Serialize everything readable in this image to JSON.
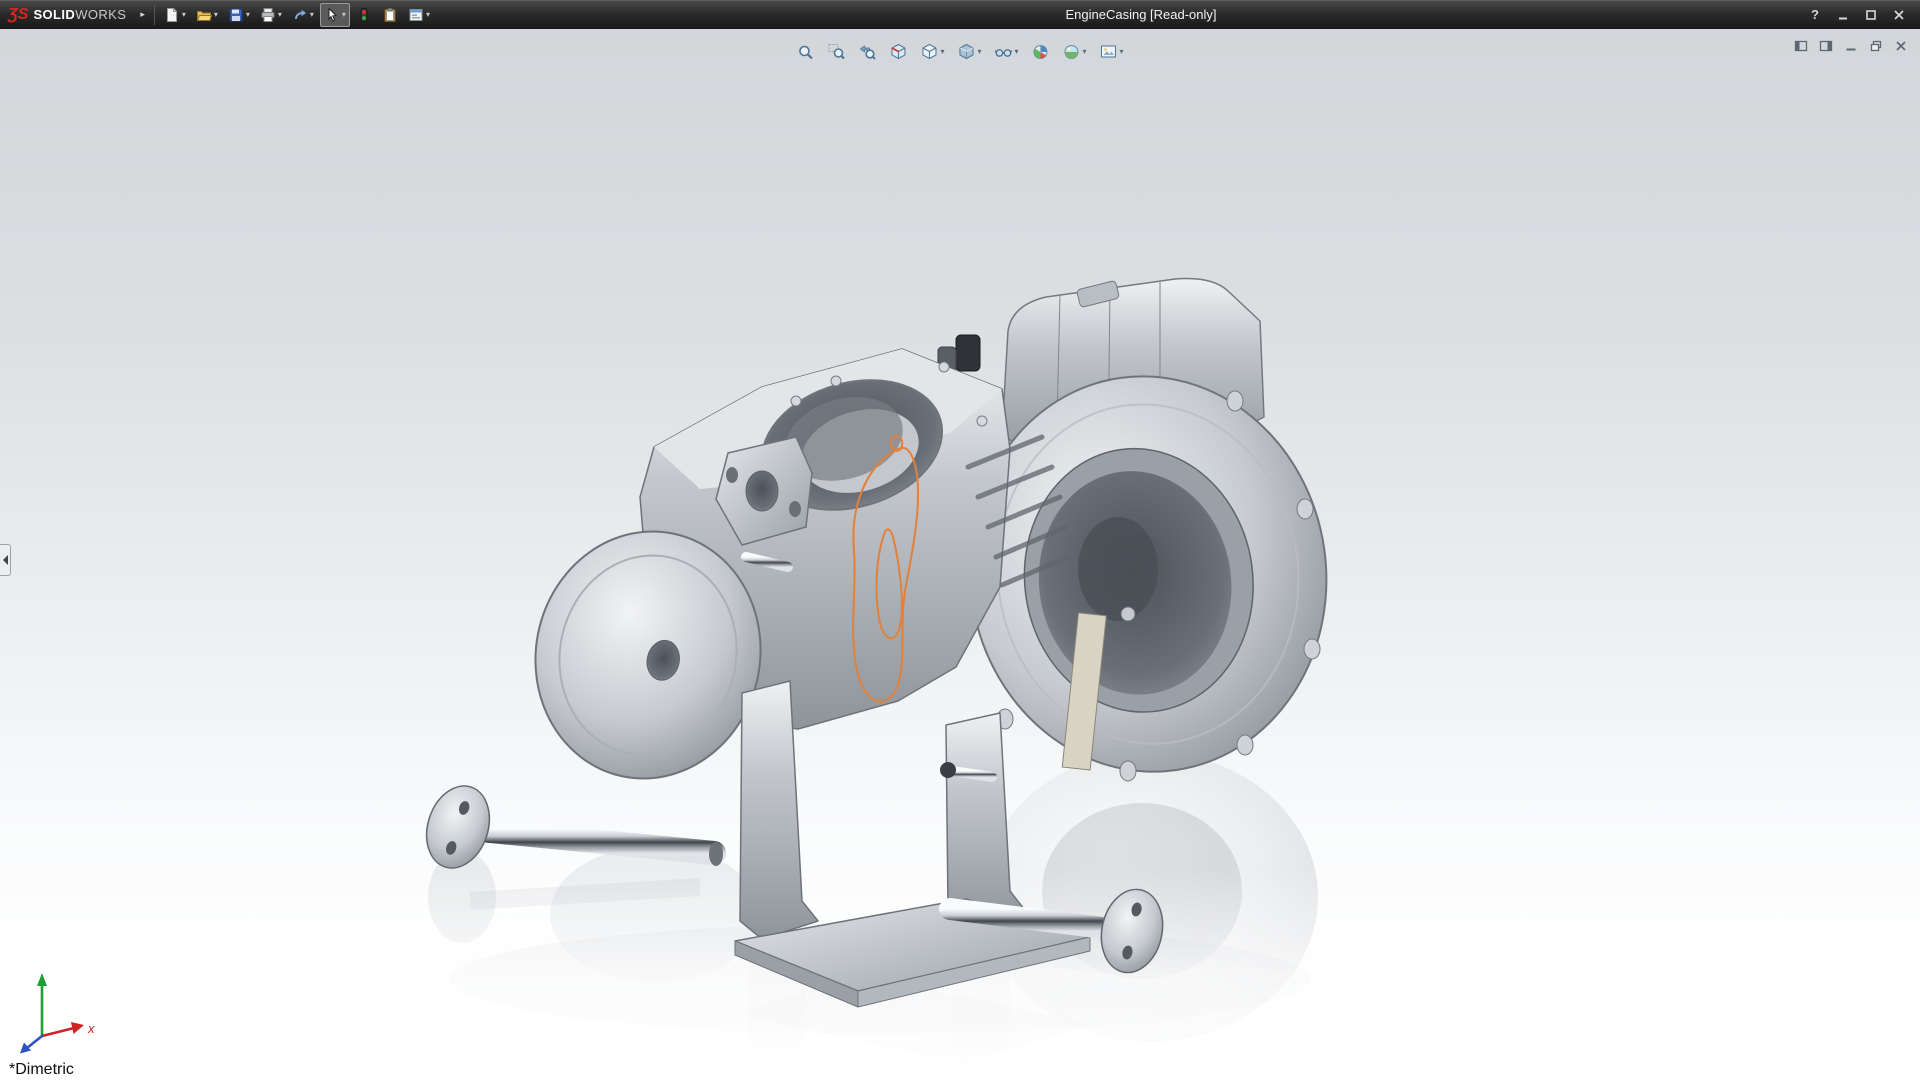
{
  "glyphs": {
    "caret": "▾",
    "menu_expand": "▸",
    "help": "?"
  },
  "titlebar": {
    "logo_mark": "ƷS",
    "brand_bold": "SOLID",
    "brand_light": "WORKS",
    "document_title": "EngineCasing [Read-only]",
    "tools": [
      {
        "name": "new-document",
        "has_dropdown": true
      },
      {
        "name": "open",
        "has_dropdown": true
      },
      {
        "name": "save",
        "has_dropdown": true
      },
      {
        "name": "print",
        "has_dropdown": true
      },
      {
        "name": "undo",
        "has_dropdown": true
      },
      {
        "name": "select",
        "has_dropdown": true,
        "active": true
      },
      {
        "name": "rebuild",
        "has_dropdown": false
      },
      {
        "name": "file-properties",
        "has_dropdown": false
      },
      {
        "name": "options",
        "has_dropdown": true
      }
    ],
    "window_controls": [
      "help",
      "minimize",
      "maximize",
      "close"
    ]
  },
  "heads_up_toolbar": {
    "tools": [
      {
        "name": "zoom-to-fit",
        "has_dropdown": false
      },
      {
        "name": "zoom-to-area",
        "has_dropdown": false
      },
      {
        "name": "previous-view",
        "has_dropdown": false
      },
      {
        "name": "section-view",
        "has_dropdown": false
      },
      {
        "name": "view-orientation",
        "has_dropdown": true
      },
      {
        "name": "display-style",
        "has_dropdown": true
      },
      {
        "name": "hide-show-items",
        "has_dropdown": true
      },
      {
        "name": "edit-appearance",
        "has_dropdown": false
      },
      {
        "name": "apply-scene",
        "has_dropdown": true
      },
      {
        "name": "view-settings",
        "has_dropdown": true
      }
    ]
  },
  "document_window_controls": [
    "pane-left",
    "pane-right",
    "minimize",
    "restore",
    "close"
  ],
  "viewport": {
    "view_label": "*Dimetric",
    "triad_x_label": "x",
    "model_subject": "engine-casing-3d-model",
    "sketch_overlay_color": "#e0813c"
  },
  "colors": {
    "titlebar_bg": "#2e2e2e",
    "brand_red": "#d8261e",
    "viewport_top": "#d5d8dc",
    "viewport_bottom": "#ffffff",
    "hud_icon": "#4f7496",
    "sketch_orange": "#e0813c",
    "triad_x": "#cc2525",
    "triad_y": "#1f9e34",
    "triad_z": "#2b50c8"
  }
}
